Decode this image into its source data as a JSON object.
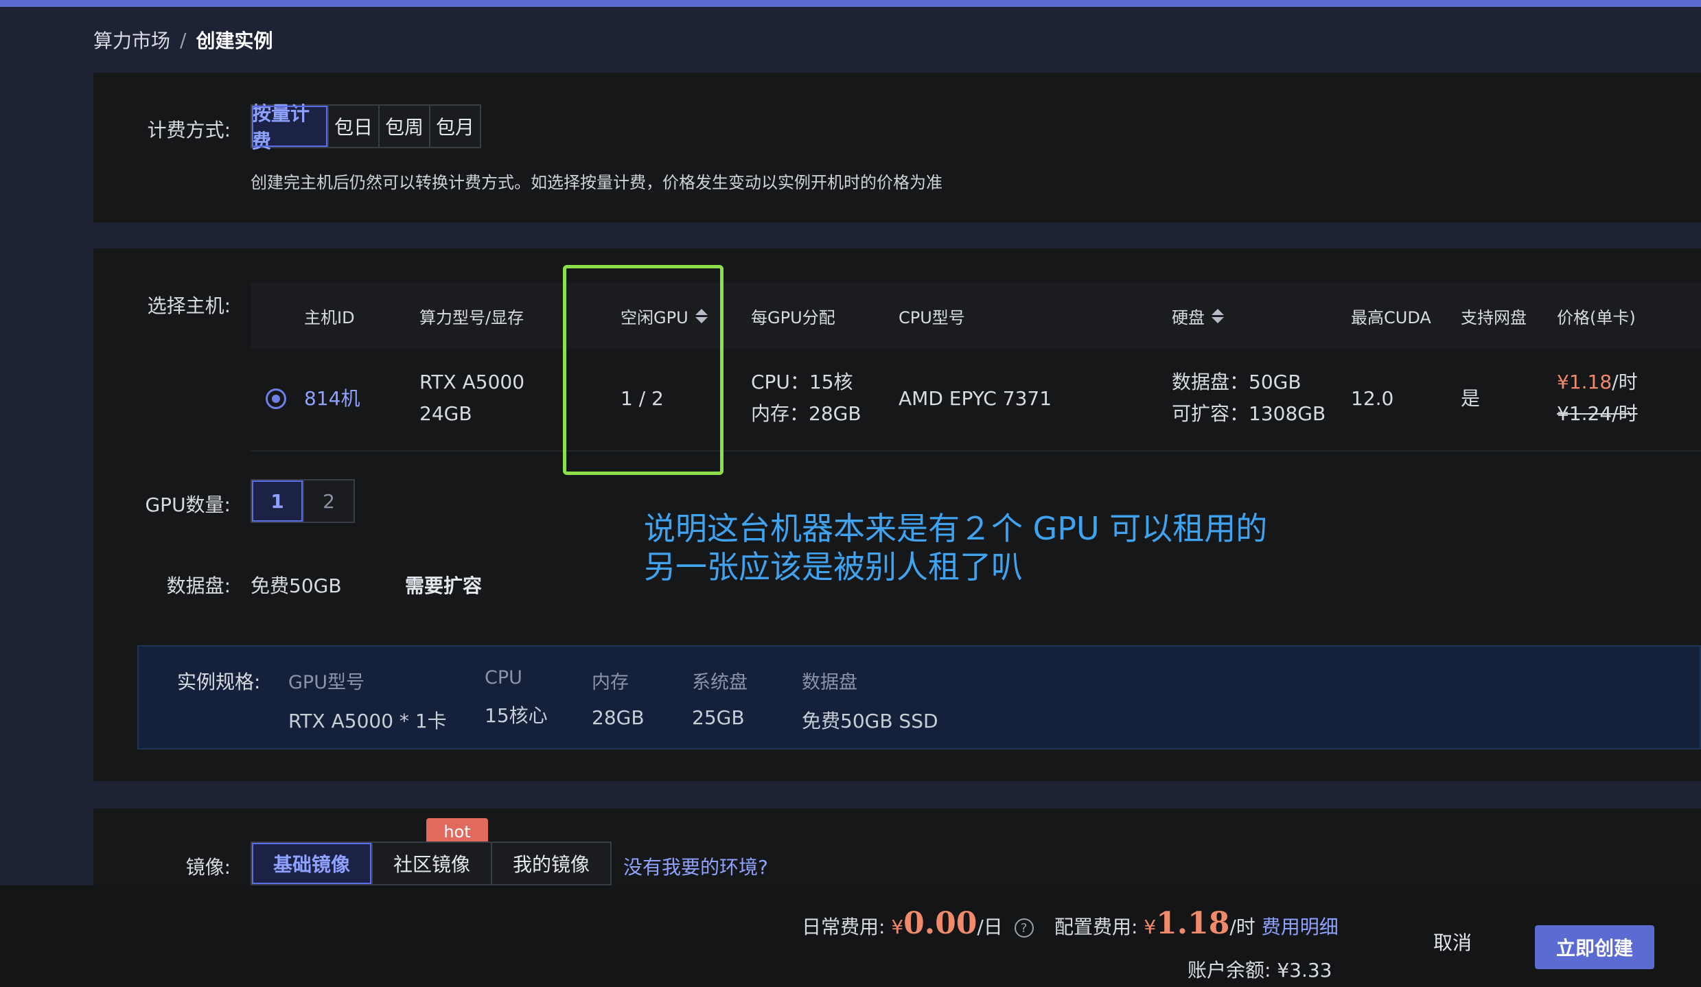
{
  "breadcrumb": {
    "parent": "算力市场",
    "separator": "/",
    "current": "创建实例"
  },
  "billing": {
    "label": "计费方式:",
    "options": [
      "按量计费",
      "包日",
      "包周",
      "包月"
    ],
    "active": "按量计费",
    "note": "创建完主机后仍然可以转换计费方式。如选择按量计费，价格发生变动以实例开机时的价格为准"
  },
  "host": {
    "label": "选择主机:",
    "columns": [
      "主机ID",
      "算力型号/显存",
      "空闲GPU",
      "每GPU分配",
      "CPU型号",
      "硬盘",
      "最高CUDA",
      "支持网盘",
      "价格(单卡)"
    ],
    "row": {
      "id": "814机",
      "gpu_model": "RTX A5000",
      "vram": "24GB",
      "free_gpu": "1 / 2",
      "cpu_alloc": "CPU：15核",
      "mem_alloc": "内存：28GB",
      "cpu_model": "AMD EPYC 7371",
      "data_disk": "数据盘：50GB",
      "expandable": "可扩容：1308GB",
      "cuda": "12.0",
      "netdisk": "是",
      "price_now": "¥1.18",
      "price_unit": "/时",
      "price_old": "¥1.24/时"
    }
  },
  "gpu_count": {
    "label": "GPU数量:",
    "options": [
      "1",
      "2"
    ],
    "active": "1"
  },
  "data_disk": {
    "label": "数据盘:",
    "free": "免费50GB",
    "expand": "需要扩容"
  },
  "spec": {
    "label": "实例规格:",
    "cols": [
      {
        "h": "GPU型号",
        "v": "RTX A5000 * 1卡"
      },
      {
        "h": "CPU",
        "v": "15核心"
      },
      {
        "h": "内存",
        "v": "28GB"
      },
      {
        "h": "系统盘",
        "v": "25GB"
      },
      {
        "h": "数据盘",
        "v": "免费50GB SSD"
      }
    ]
  },
  "annotation": {
    "line1": "说明这台机器本来是有２个 GPU 可以租用的",
    "line2": "另一张应该是被别人租了叭"
  },
  "image": {
    "label": "镜像:",
    "options": [
      "基础镜像",
      "社区镜像",
      "我的镜像"
    ],
    "active": "基础镜像",
    "hot_badge": "hot",
    "no_env_link": "没有我要的环境?"
  },
  "footer": {
    "daily_label": "日常费用:",
    "daily_currency": "¥",
    "daily_value": "0.00",
    "daily_unit": "/日",
    "config_label": "配置费用:",
    "config_currency": "¥",
    "config_value": "1.18",
    "config_unit": "/时",
    "fee_detail": "费用明细",
    "balance": "账户余额: ¥3.33",
    "cancel": "取消",
    "create": "立即创建"
  },
  "colors": {
    "accent": "#5b6bd1",
    "link": "#8fa2ff",
    "price": "#f08a6a",
    "highlight": "#8ee04a",
    "annotation": "#3fa3f0"
  }
}
